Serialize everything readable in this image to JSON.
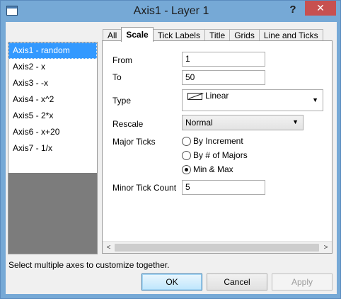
{
  "window": {
    "title": "Axis1 - Layer 1",
    "help": "?",
    "close": "✕"
  },
  "axes": {
    "items": [
      {
        "label": "Axis1 - random"
      },
      {
        "label": "Axis2 - x"
      },
      {
        "label": "Axis3 - -x"
      },
      {
        "label": "Axis4 - x^2"
      },
      {
        "label": "Axis5 - 2*x"
      },
      {
        "label": "Axis6 - x+20"
      },
      {
        "label": "Axis7 - 1/x"
      }
    ],
    "selected": "Axis1 - random",
    "hint": "Select multiple axes to customize together."
  },
  "tabs": {
    "items": [
      {
        "label": "All"
      },
      {
        "label": "Scale"
      },
      {
        "label": "Tick Labels"
      },
      {
        "label": "Title"
      },
      {
        "label": "Grids"
      },
      {
        "label": "Line and Ticks"
      }
    ],
    "active": "Scale"
  },
  "scale": {
    "from_label": "From",
    "from_value": "1",
    "to_label": "To",
    "to_value": "50",
    "type_label": "Type",
    "type_value": "Linear",
    "rescale_label": "Rescale",
    "rescale_value": "Normal",
    "major_ticks_label": "Major Ticks",
    "major_options": [
      {
        "label": "By Increment",
        "checked": false
      },
      {
        "label": "By # of Majors",
        "checked": false
      },
      {
        "label": "Min & Max",
        "checked": true
      }
    ],
    "minor_label": "Minor Tick Count",
    "minor_value": "5"
  },
  "scrollbar": {
    "left": "<",
    "right": ">"
  },
  "buttons": {
    "ok": "OK",
    "cancel": "Cancel",
    "apply": "Apply"
  }
}
